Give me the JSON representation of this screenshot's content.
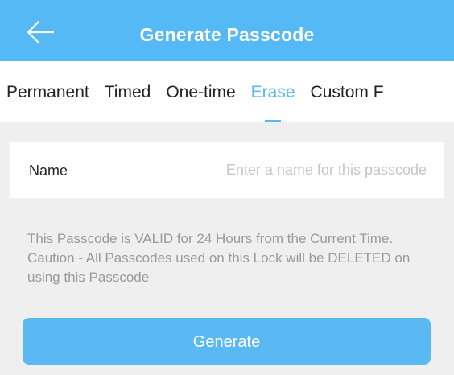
{
  "header": {
    "title": "Generate Passcode",
    "back_icon": "arrow-left-icon",
    "background_color": "#55b9f5"
  },
  "tabs": [
    {
      "label": "Permanent",
      "active": false
    },
    {
      "label": "Timed",
      "active": false
    },
    {
      "label": "One-time",
      "active": false
    },
    {
      "label": "Erase",
      "active": true
    },
    {
      "label": "Custom F",
      "active": false
    }
  ],
  "form": {
    "name_label": "Name",
    "name_value": "",
    "name_placeholder": "Enter a name for this passcode"
  },
  "info_text": "This Passcode is VALID for 24 Hours from the Current Time. Caution - All Passcodes used on this Lock will be DELETED on using this Passcode",
  "generate_button": {
    "label": "Generate",
    "color": "#5ab9f3"
  },
  "colors": {
    "accent": "#55b9f5",
    "background": "#efefef",
    "hint_text": "#9a9a9a",
    "placeholder": "#c6c6c6"
  }
}
